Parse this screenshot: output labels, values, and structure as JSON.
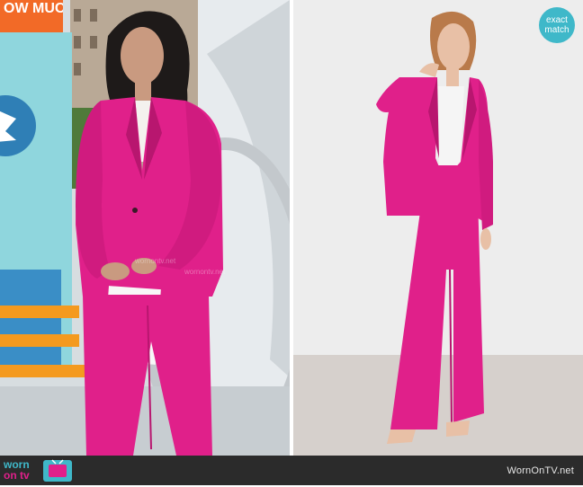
{
  "tv_screen": {
    "headline": "OW MUCH",
    "watermark": "wornontv.net"
  },
  "product_badge": {
    "line1": "exact",
    "line2": "match"
  },
  "footer": {
    "logo_word1": "worn",
    "logo_word2": "on tv",
    "site": "WornOnTV.net"
  },
  "colors": {
    "suit": "#e0208a",
    "suit_shadow": "#b8166f",
    "badge": "#3fb8c9",
    "footer": "#2b2b2b",
    "headline": "#f26a27"
  }
}
